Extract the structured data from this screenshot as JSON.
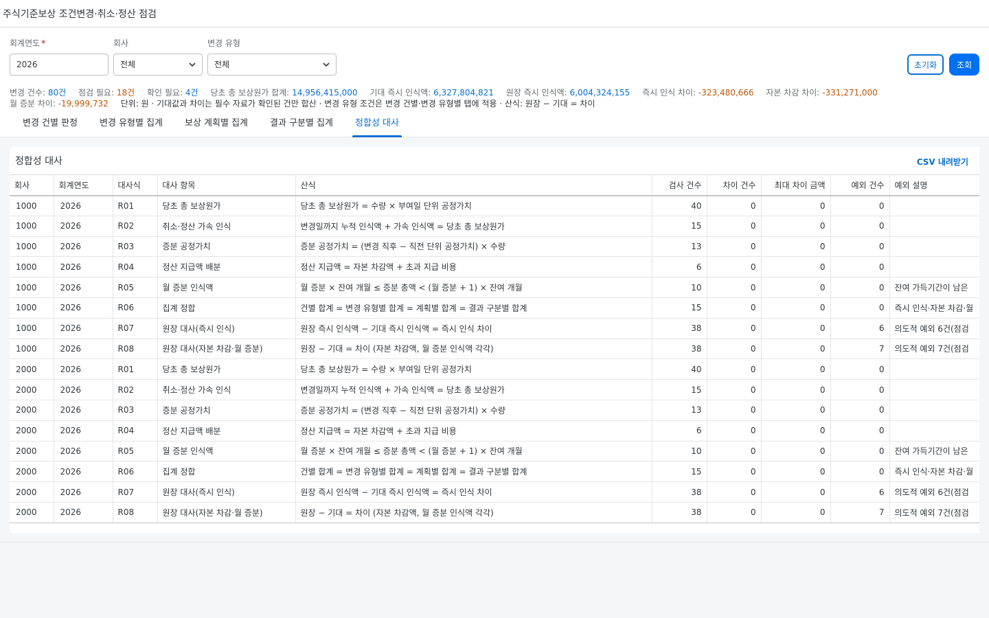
{
  "header": {
    "title": "주식기준보상 조건변경·취소·정산 점검"
  },
  "filters": {
    "fiscal_year": {
      "label": "회계연도",
      "required_mark": "*",
      "value": "2026"
    },
    "company": {
      "label": "회사",
      "value": "전체"
    },
    "change_type": {
      "label": "변경 유형",
      "value": "전체"
    }
  },
  "buttons": {
    "reset_label": "초기화",
    "search_label": "조회"
  },
  "summary": {
    "items": [
      {
        "label": "변경 건수:",
        "value": "80건",
        "tone": "blue"
      },
      {
        "label": "점검 필요:",
        "value": "18건",
        "tone": "orange"
      },
      {
        "label": "확인 필요:",
        "value": "4건",
        "tone": "blue"
      },
      {
        "label": "당초 총 보상원가 합계:",
        "value": "14,956,415,000",
        "tone": "blue"
      },
      {
        "label": "기대 즉시 인식액:",
        "value": "6,327,804,821",
        "tone": "blue"
      },
      {
        "label": "원장 즉시 인식액:",
        "value": "6,004,324,155",
        "tone": "blue"
      },
      {
        "label": "즉시 인식 차이:",
        "value": "-323,480,666",
        "tone": "orange"
      },
      {
        "label": "자본 차감 차이:",
        "value": "-331,271,000",
        "tone": "orange"
      },
      {
        "label": "월 증분 차이:",
        "value": "-19,999,732",
        "tone": "orange"
      }
    ],
    "note": "단위: 원 · 기대값과 차이는 필수 자료가 확인된 건만 합산 · 변경 유형 조건은 변경 건별·변경 유형별 탭에 적용 · 산식: 원장 − 기대 = 차이"
  },
  "tabs": [
    {
      "label": "변경 건별 판정",
      "active": false
    },
    {
      "label": "변경 유형별 집계",
      "active": false
    },
    {
      "label": "보상 계획별 집계",
      "active": false
    },
    {
      "label": "결과 구분별 집계",
      "active": false
    },
    {
      "label": "정합성 대사",
      "active": true
    }
  ],
  "panel": {
    "title": "정합성 대사",
    "csv_label": "CSV 내려받기"
  },
  "table": {
    "columns": [
      "회사",
      "회계연도",
      "대사식",
      "대사 항목",
      "산식",
      "검사 건수",
      "차이 건수",
      "최대 차이 금액",
      "예외 건수",
      "예외 설명"
    ],
    "rows": [
      [
        "1000",
        "2026",
        "R01",
        "당초 총 보상원가",
        "당초 총 보상원가 = 수량 × 부여일 단위 공정가치",
        "40",
        "0",
        "0",
        "0",
        ""
      ],
      [
        "1000",
        "2026",
        "R02",
        "취소·정산 가속 인식",
        "변경일까지 누적 인식액 + 가속 인식액 = 당초 총 보상원가",
        "15",
        "0",
        "0",
        "0",
        ""
      ],
      [
        "1000",
        "2026",
        "R03",
        "증분 공정가치",
        "증분 공정가치 = (변경 직후 − 직전 단위 공정가치) × 수량",
        "13",
        "0",
        "0",
        "0",
        ""
      ],
      [
        "1000",
        "2026",
        "R04",
        "정산 지급액 배분",
        "정산 지급액 = 자본 차감액 + 초과 지급 비용",
        "6",
        "0",
        "0",
        "0",
        ""
      ],
      [
        "1000",
        "2026",
        "R05",
        "월 증분 인식액",
        "월 증분 × 잔여 개월 ≤ 증분 총액 < (월 증분 + 1) × 잔여 개월",
        "10",
        "0",
        "0",
        "0",
        "잔여 가득기간이 남은"
      ],
      [
        "1000",
        "2026",
        "R06",
        "집계 정합",
        "건별 합계 = 변경 유형별 합계 = 계획별 합계 = 결과 구분별 합계",
        "15",
        "0",
        "0",
        "0",
        "즉시 인식·자본 차감·월"
      ],
      [
        "1000",
        "2026",
        "R07",
        "원장 대사(즉시 인식)",
        "원장 즉시 인식액 − 기대 즉시 인식액 = 즉시 인식 차이",
        "38",
        "0",
        "0",
        "6",
        "의도적 예외 6건(점검"
      ],
      [
        "1000",
        "2026",
        "R08",
        "원장 대사(자본 차감·월 증분)",
        "원장 − 기대 = 차이 (자본 차감액, 월 증분 인식액 각각)",
        "38",
        "0",
        "0",
        "7",
        "의도적 예외 7건(점검"
      ],
      [
        "2000",
        "2026",
        "R01",
        "당초 총 보상원가",
        "당초 총 보상원가 = 수량 × 부여일 단위 공정가치",
        "40",
        "0",
        "0",
        "0",
        ""
      ],
      [
        "2000",
        "2026",
        "R02",
        "취소·정산 가속 인식",
        "변경일까지 누적 인식액 + 가속 인식액 = 당초 총 보상원가",
        "15",
        "0",
        "0",
        "0",
        ""
      ],
      [
        "2000",
        "2026",
        "R03",
        "증분 공정가치",
        "증분 공정가치 = (변경 직후 − 직전 단위 공정가치) × 수량",
        "13",
        "0",
        "0",
        "0",
        ""
      ],
      [
        "2000",
        "2026",
        "R04",
        "정산 지급액 배분",
        "정산 지급액 = 자본 차감액 + 초과 지급 비용",
        "6",
        "0",
        "0",
        "0",
        ""
      ],
      [
        "2000",
        "2026",
        "R05",
        "월 증분 인식액",
        "월 증분 × 잔여 개월 ≤ 증분 총액 < (월 증분 + 1) × 잔여 개월",
        "10",
        "0",
        "0",
        "0",
        "잔여 가득기간이 남은"
      ],
      [
        "2000",
        "2026",
        "R06",
        "집계 정합",
        "건별 합계 = 변경 유형별 합계 = 계획별 합계 = 결과 구분별 합계",
        "15",
        "0",
        "0",
        "0",
        "즉시 인식·자본 차감·월"
      ],
      [
        "2000",
        "2026",
        "R07",
        "원장 대사(즉시 인식)",
        "원장 즉시 인식액 − 기대 즉시 인식액 = 즉시 인식 차이",
        "38",
        "0",
        "0",
        "6",
        "의도적 예외 6건(점검"
      ],
      [
        "2000",
        "2026",
        "R08",
        "원장 대사(자본 차감·월 증분)",
        "원장 − 기대 = 차이 (자본 차감액, 월 증분 인식액 각각)",
        "38",
        "0",
        "0",
        "7",
        "의도적 예외 7건(점검"
      ]
    ]
  },
  "icons": {
    "select_chevron": "chevron-down-icon"
  },
  "colors": {
    "accent": "#0a6ed1",
    "primary_button": "#0070f2",
    "warning_value": "#c35500"
  }
}
